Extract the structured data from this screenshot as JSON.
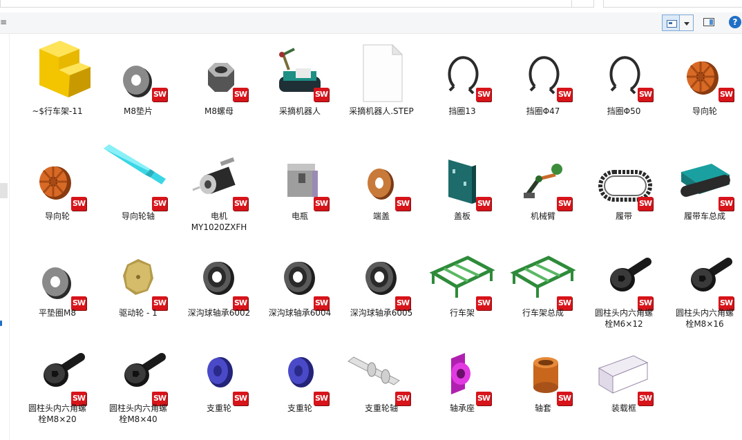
{
  "toolbar": {
    "edge_glyph": "≡",
    "help_label": "?"
  },
  "sw_badge_text": "SW",
  "colors": {
    "badge_red": "#d7141a",
    "accent_blue": "#1f6fc7",
    "selection_blue": "#dbe9f8"
  },
  "files": [
    {
      "name": "~$行车架-11",
      "icon": "assembly-lock-icon"
    },
    {
      "name": "M8垫片",
      "icon": "washer-icon"
    },
    {
      "name": "M8螺母",
      "icon": "hex-nut-icon"
    },
    {
      "name": "采摘机器人",
      "icon": "robot-assembly-icon"
    },
    {
      "name": "采摘机器人.STEP",
      "icon": "blank-document-icon"
    },
    {
      "name": "挡圈13",
      "icon": "retaining-ring-icon"
    },
    {
      "name": "挡圈Φ47",
      "icon": "retaining-ring-icon"
    },
    {
      "name": "挡圈Φ50",
      "icon": "retaining-ring-icon"
    },
    {
      "name": "导向轮",
      "icon": "orange-wheel-icon"
    },
    {
      "name": "导向轮",
      "icon": "orange-wheel-icon"
    },
    {
      "name": "导向轮轴",
      "icon": "shaft-icon"
    },
    {
      "name": "电机\nMY1020ZXFH",
      "icon": "motor-icon"
    },
    {
      "name": "电瓶",
      "icon": "battery-icon"
    },
    {
      "name": "端盖",
      "icon": "end-cap-icon"
    },
    {
      "name": "盖板",
      "icon": "cover-plate-icon"
    },
    {
      "name": "机械臂",
      "icon": "robot-arm-icon"
    },
    {
      "name": "履带",
      "icon": "track-icon"
    },
    {
      "name": "履带车总成",
      "icon": "tracked-vehicle-icon"
    },
    {
      "name": "平垫圈M8",
      "icon": "washer-icon"
    },
    {
      "name": "驱动轮 - 1",
      "icon": "sprocket-icon"
    },
    {
      "name": "深沟球轴承6002",
      "icon": "bearing-icon"
    },
    {
      "name": "深沟球轴承6004",
      "icon": "bearing-icon"
    },
    {
      "name": "深沟球轴承6005",
      "icon": "bearing-icon"
    },
    {
      "name": "行车架",
      "icon": "frame-icon"
    },
    {
      "name": "行车架总成",
      "icon": "frame-icon"
    },
    {
      "name": "圆柱头内六角螺\n栓M6×12",
      "icon": "socket-bolt-icon"
    },
    {
      "name": "圆柱头内六角螺\n栓M8×16",
      "icon": "socket-bolt-icon"
    },
    {
      "name": "圆柱头内六角螺\n栓M8×20",
      "icon": "socket-bolt-icon"
    },
    {
      "name": "圆柱头内六角螺\n栓M8×40",
      "icon": "socket-bolt-icon"
    },
    {
      "name": "支重轮",
      "icon": "road-wheel-icon"
    },
    {
      "name": "支重轮",
      "icon": "road-wheel-icon"
    },
    {
      "name": "支重轮轴",
      "icon": "wheel-shaft-icon"
    },
    {
      "name": "轴承座",
      "icon": "bearing-housing-icon"
    },
    {
      "name": "轴套",
      "icon": "bushing-icon"
    },
    {
      "name": "装载框",
      "icon": "tray-icon"
    }
  ]
}
